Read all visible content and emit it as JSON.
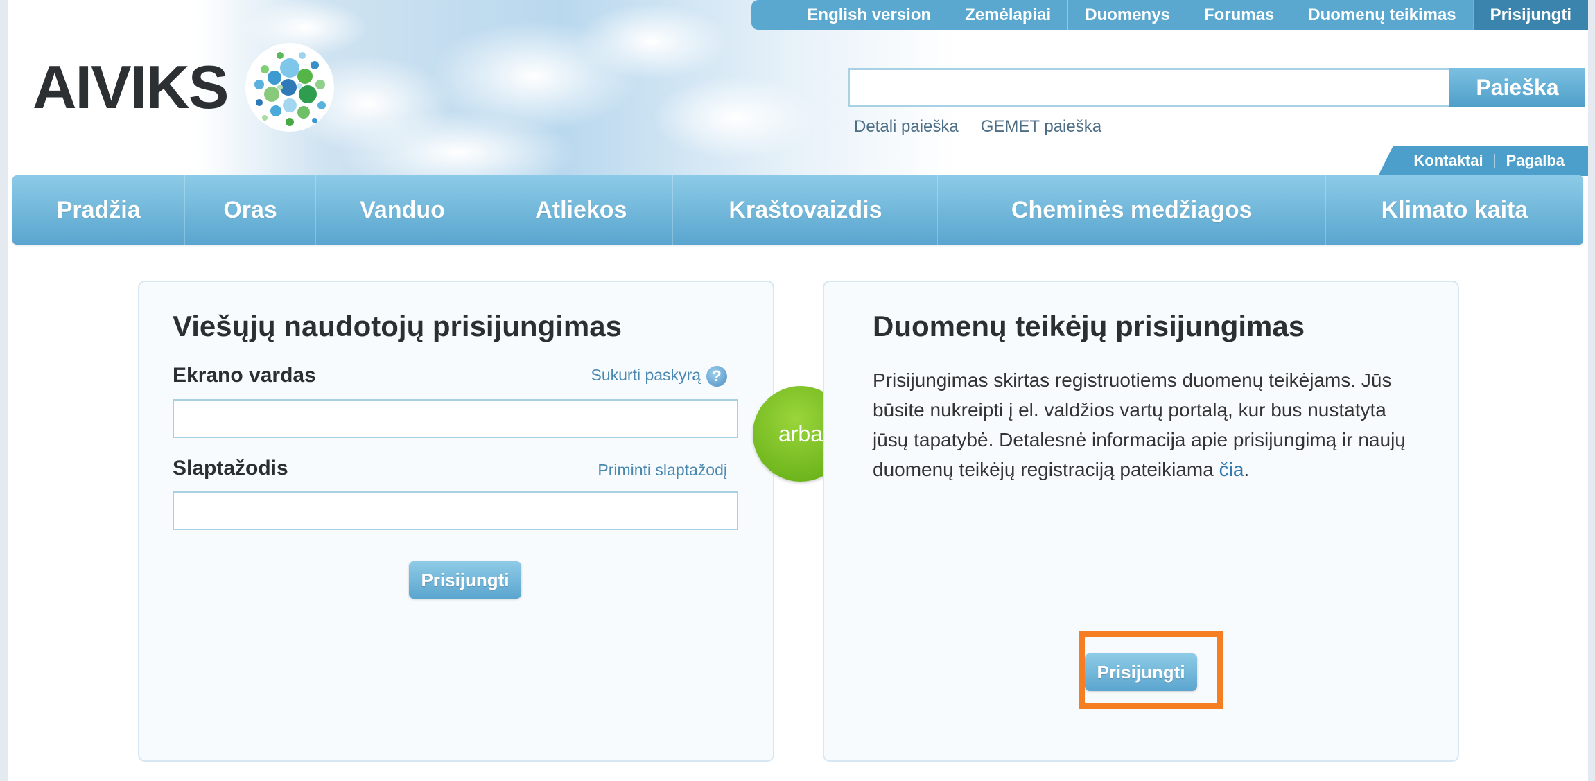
{
  "brand": {
    "name": "AIVIKS"
  },
  "top_nav": {
    "items": [
      "English version",
      "Zemėlapiai",
      "Duomenys",
      "Forumas",
      "Duomenų teikimas",
      "Prisijungti"
    ]
  },
  "search": {
    "value": "",
    "placeholder": "",
    "button_label": "Paieška",
    "links": [
      "Detali paieška",
      "GEMET paieška"
    ]
  },
  "util_nav": {
    "items": [
      "Kontaktai",
      "Pagalba"
    ]
  },
  "main_nav": {
    "items": [
      "Pradžia",
      "Oras",
      "Vanduo",
      "Atliekos",
      "Kraštovaizdis",
      "Cheminės medžiagos",
      "Klimato kaita"
    ]
  },
  "public_login": {
    "title": "Viešųjų naudotojų prisijungimas",
    "username_label": "Ekrano vardas",
    "create_account_link": "Sukurti paskyrą",
    "username_value": "",
    "password_label": "Slaptažodis",
    "remind_password_link": "Priminti slaptažodį",
    "password_value": "",
    "submit_label": "Prisijungti"
  },
  "separator": {
    "label": "arba"
  },
  "provider_login": {
    "title": "Duomenų teikėjų prisijungimas",
    "description": "Prisijungimas skirtas registruotiems duomenų teikėjams. Jūs būsite nukreipti į el. valdžios vartų portalą, kur bus nustatyta jūsų tapatybė. Detalesnė informacija apie prisijungimą ir naujų duomenų teikėjų registraciją pateikiama",
    "link_text": "čia",
    "suffix": ".",
    "submit_label": "Prisijungti"
  },
  "colors": {
    "nav_blue": "#5aa5cf",
    "top_nav_active": "#3b84ad",
    "arba_green": "#6ab51c",
    "highlight_orange": "#f57e22"
  },
  "icons": {
    "help": "question-mark-circle",
    "logo": "bubble-cluster"
  }
}
